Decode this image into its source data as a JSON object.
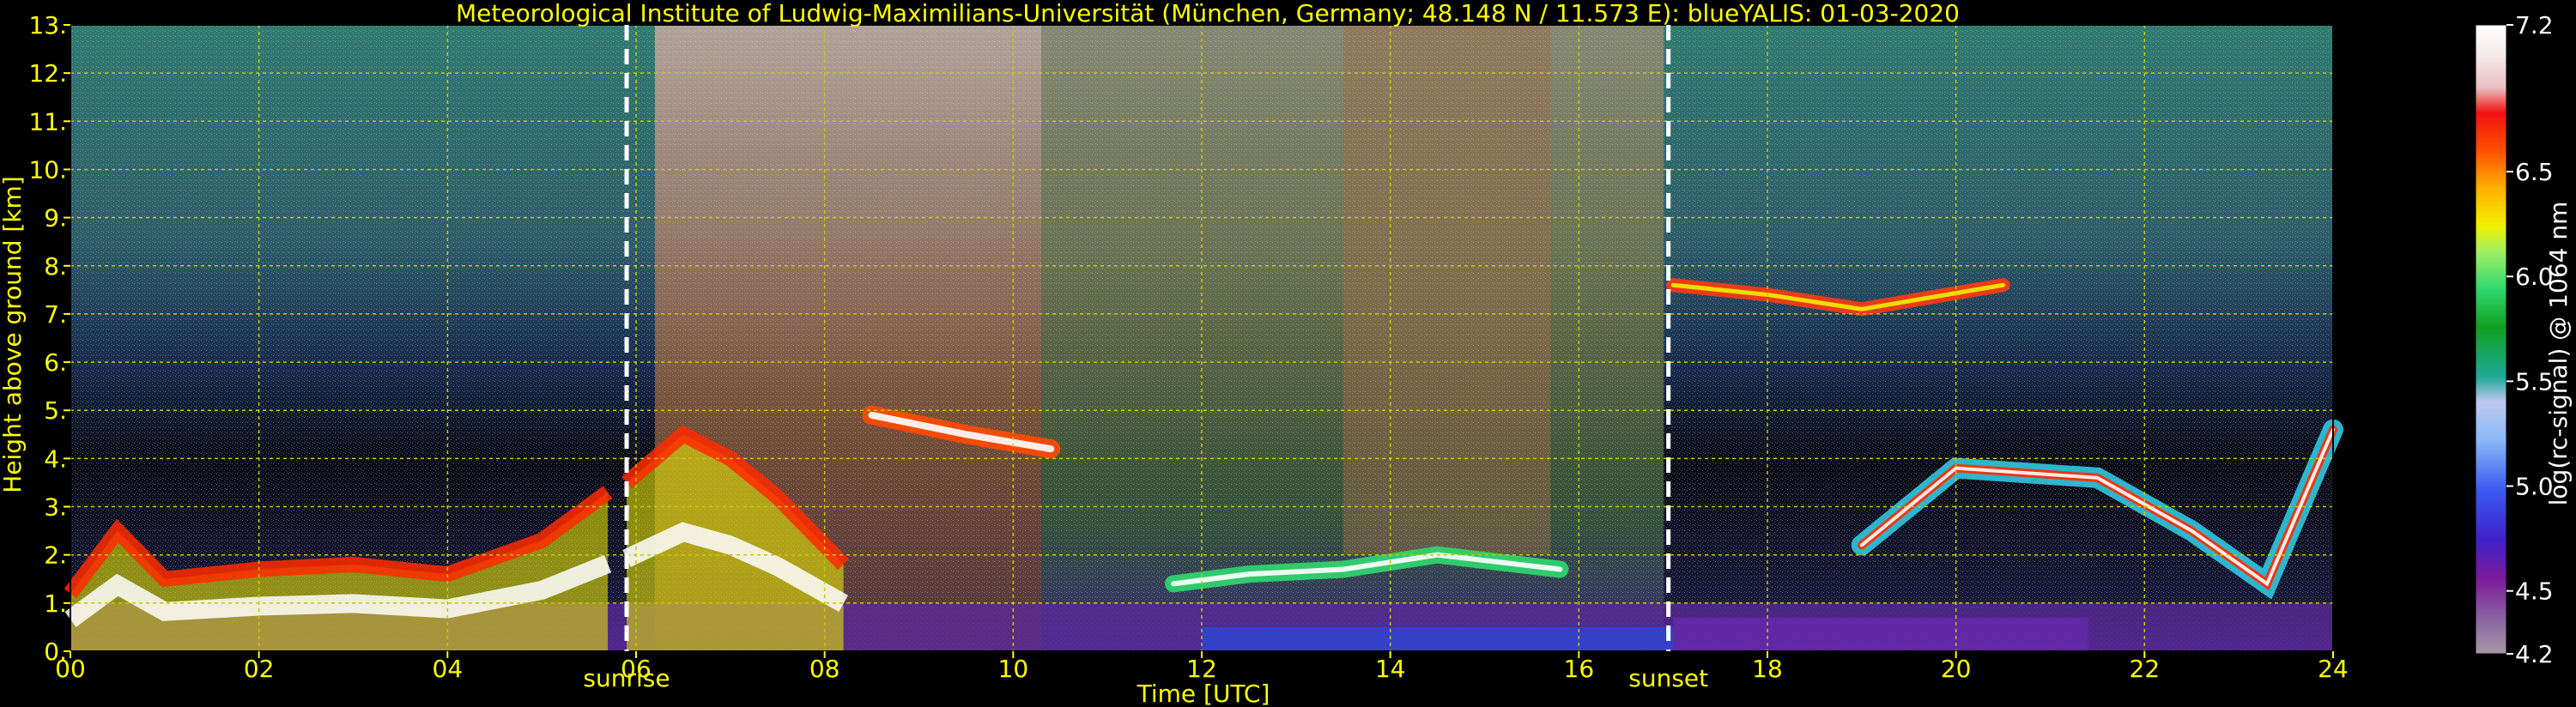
{
  "chart_data": {
    "type": "heatmap",
    "title": "Meteorological Institute of Ludwig-Maximilians-Universität (München, Germany; 48.148 N / 11.573 E):     blueYALIS: 01-03-2020",
    "xlabel": "Time [UTC]",
    "ylabel": "Height above ground [km]",
    "xlim": [
      0,
      24
    ],
    "ylim": [
      0,
      13
    ],
    "x_ticks": [
      "00",
      "02",
      "04",
      "06",
      "08",
      "10",
      "12",
      "14",
      "16",
      "18",
      "20",
      "22",
      "24"
    ],
    "x_tick_values": [
      0,
      2,
      4,
      6,
      8,
      10,
      12,
      14,
      16,
      18,
      20,
      22,
      24
    ],
    "y_ticks": [
      "0.",
      "1.",
      "2.",
      "3.",
      "4.",
      "5.",
      "6.",
      "7.",
      "8.",
      "9.",
      "10.",
      "11.",
      "12.",
      "13."
    ],
    "y_tick_values": [
      0,
      1,
      2,
      3,
      4,
      5,
      6,
      7,
      8,
      9,
      10,
      11,
      12,
      13
    ],
    "grid": true,
    "events": [
      {
        "name": "sunrise",
        "time": 5.9
      },
      {
        "name": "sunset",
        "time": 16.95
      }
    ],
    "colorbar": {
      "label": "log(rc-signal) @ 1064 nm",
      "range": [
        4.2,
        7.2
      ],
      "ticks": [
        "4.2",
        "4.5",
        "5.0",
        "5.5",
        "6.0",
        "6.5",
        "7.2"
      ],
      "tick_values": [
        4.2,
        4.5,
        5.0,
        5.5,
        6.0,
        6.5,
        7.2
      ]
    },
    "features": {
      "boundary_layer_night_top": [
        [
          0.0,
          1.2
        ],
        [
          0.5,
          2.5
        ],
        [
          1.0,
          1.5
        ],
        [
          2.0,
          1.7
        ],
        [
          3.0,
          1.8
        ],
        [
          4.0,
          1.6
        ],
        [
          5.0,
          2.3
        ],
        [
          5.7,
          3.3
        ]
      ],
      "boundary_layer_day_top": [
        [
          5.9,
          3.5
        ],
        [
          6.5,
          4.5
        ],
        [
          7.0,
          4.0
        ],
        [
          7.5,
          3.2
        ],
        [
          8.2,
          1.8
        ]
      ],
      "elevated_layer_morning": [
        [
          8.5,
          4.9
        ],
        [
          9.5,
          4.5
        ],
        [
          10.4,
          4.2
        ]
      ],
      "cloud_base_midday": [
        [
          11.7,
          1.4
        ],
        [
          12.5,
          1.6
        ],
        [
          13.5,
          1.7
        ],
        [
          14.5,
          2.0
        ],
        [
          15.8,
          1.7
        ]
      ],
      "cirrus_evening": [
        [
          17.0,
          7.6
        ],
        [
          18.0,
          7.4
        ],
        [
          19.0,
          7.1
        ],
        [
          20.5,
          7.6
        ]
      ],
      "evening_layers": [
        [
          19.0,
          2.2
        ],
        [
          20.0,
          3.8
        ],
        [
          21.5,
          3.6
        ],
        [
          22.5,
          2.5
        ],
        [
          23.3,
          1.4
        ],
        [
          24.0,
          4.6
        ]
      ]
    },
    "colors": {
      "text": "#ffff00",
      "grid": "#c8c800",
      "event_line": "#ffffff",
      "background": "#000000"
    }
  }
}
